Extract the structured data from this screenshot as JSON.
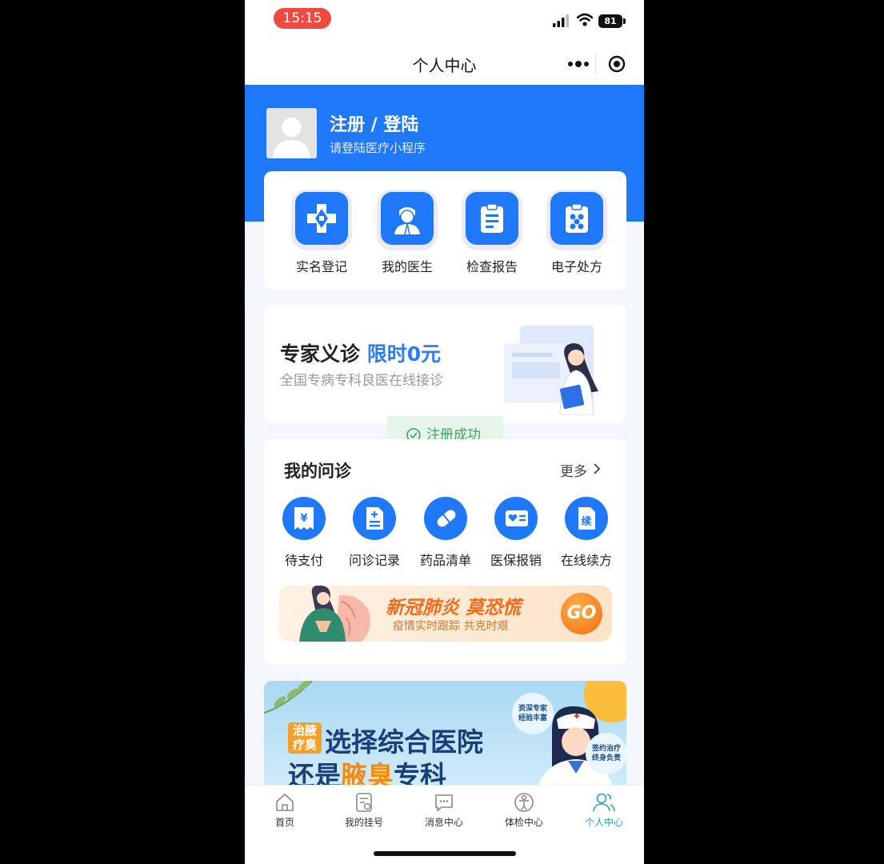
{
  "status_bar": {
    "time": "15:15",
    "battery": "81"
  },
  "nav": {
    "title": "个人中心"
  },
  "profile": {
    "title": "注册 / 登陆",
    "subtitle": "请登陆医疗小程序"
  },
  "quick_actions": [
    {
      "label": "实名登记",
      "icon": "medical-cross-icon"
    },
    {
      "label": "我的医生",
      "icon": "doctor-icon"
    },
    {
      "label": "检查报告",
      "icon": "clipboard-icon"
    },
    {
      "label": "电子处方",
      "icon": "prescription-icon"
    }
  ],
  "promo": {
    "title": "专家义诊",
    "highlight": "限时0元",
    "subtitle": "全国专病专科良医在线接诊"
  },
  "toast": {
    "text": "注册成功"
  },
  "consultation": {
    "title": "我的问诊",
    "more": "更多",
    "items": [
      {
        "label": "待支付",
        "icon": "payment-icon"
      },
      {
        "label": "问诊记录",
        "icon": "record-icon"
      },
      {
        "label": "药品清单",
        "icon": "pill-icon"
      },
      {
        "label": "医保报销",
        "icon": "insurance-card-icon"
      },
      {
        "label": "在线续方",
        "icon": "renew-icon"
      }
    ]
  },
  "covid_banner": {
    "title": "新冠肺炎 莫恐慌",
    "subtitle": "疫情实时跟踪 共克时艰",
    "button": "GO"
  },
  "ad_banner": {
    "tag_line1": "治腋",
    "tag_line2": "疗臭",
    "line1": "选择综合医院",
    "line2_prefix": "还是",
    "line2_highlight": "腋臭",
    "line2_suffix": "专科",
    "badge1_line1": "资深专家",
    "badge1_line2": "经验丰富",
    "badge2_line1": "签约治疗",
    "badge2_line2": "终身负责"
  },
  "tabs": [
    {
      "label": "首页",
      "icon": "home-icon",
      "active": false
    },
    {
      "label": "我的挂号",
      "icon": "registration-icon",
      "active": false
    },
    {
      "label": "消息中心",
      "icon": "message-icon",
      "active": false
    },
    {
      "label": "体检中心",
      "icon": "checkup-icon",
      "active": false
    },
    {
      "label": "个人中心",
      "icon": "user-icon",
      "active": true
    }
  ],
  "colors": {
    "primary": "#1f78f7",
    "tab_active": "#1ea3c9",
    "toast_green": "#3aa36a",
    "promo_orange": "#f36c1c"
  }
}
